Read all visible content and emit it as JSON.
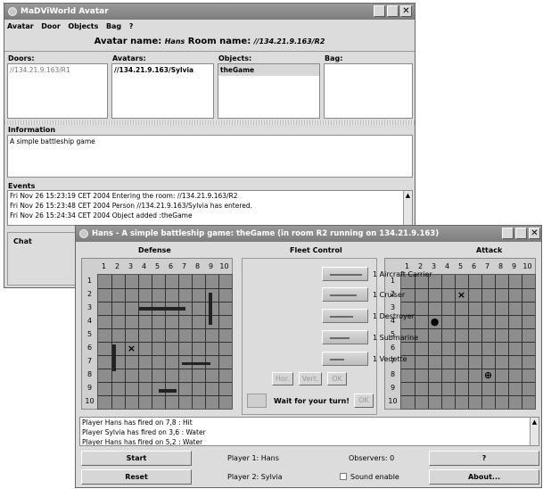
{
  "avatar_window": {
    "title": "MaDViWorld Avatar",
    "menu": [
      "Avatar",
      "Door",
      "Objects",
      "Bag",
      "?"
    ],
    "header": {
      "avatar_label": "Avatar name:",
      "avatar_value": "Hans",
      "room_label": "Room name:",
      "room_value": "//134.21.9.163/R2"
    },
    "columns": {
      "doors": {
        "title": "Doors:",
        "items": [
          "//134.21.9.163/R1"
        ]
      },
      "avatars": {
        "title": "Avatars:",
        "items": [
          "//134.21.9.163/Sylvia"
        ]
      },
      "objects": {
        "title": "Objects:",
        "items": [
          "theGame"
        ]
      },
      "bag": {
        "title": "Bag:",
        "items": []
      }
    },
    "information": {
      "title": "Information",
      "text": "A simple battleship game"
    },
    "events": {
      "title": "Events",
      "lines": [
        "Fri Nov 26 15:23:19 CET 2004 Entering the room: //134.21.9.163/R2",
        "Fri Nov 26 15:23:48 CET 2004 Person //134.21.9.163/Sylvia has entered.",
        "Fri Nov 26 15:24:34 CET 2004 Object added :theGame"
      ]
    },
    "chat": {
      "title": "Chat"
    }
  },
  "game_window": {
    "title": "Hans - A simple battleship game: theGame (in room R2 running on 134.21.9.163)",
    "defense_title": "Defense",
    "fleet_title": "Fleet Control",
    "attack_title": "Attack",
    "column_labels": [
      "1",
      "2",
      "3",
      "4",
      "5",
      "6",
      "7",
      "8",
      "9",
      "10"
    ],
    "row_labels": [
      "1",
      "2",
      "3",
      "4",
      "5",
      "6",
      "7",
      "8",
      "9",
      "10"
    ],
    "defense_marks": [
      {
        "row": 6,
        "col": 3,
        "symbol": "×"
      }
    ],
    "attack_marks": [
      {
        "row": 2,
        "col": 5,
        "symbol": "×"
      },
      {
        "row": 4,
        "col": 3,
        "symbol": "●"
      },
      {
        "row": 8,
        "col": 7,
        "symbol": "⊕"
      }
    ],
    "fleet": [
      "1 Aircraft Carrier",
      "1 Cruiser",
      "1 Destroyer",
      "1 Submarine",
      "1 Vedette"
    ],
    "orientation_buttons": [
      "Hor.",
      "Vert.",
      "OK"
    ],
    "turn_message": "Wait for your turn!",
    "turn_ok": "OK",
    "log": [
      "Player Hans has fired on 7,8 : Hit",
      "Player Sylvia has fired on 3,6 : Water",
      "Player Hans has fired on 5,2 : Water"
    ],
    "bottom": {
      "start": "Start",
      "reset": "Reset",
      "player1": "Player 1: Hans",
      "player2": "Player 2: Sylvia",
      "observers": "Observers: 0",
      "sound": "Sound enable",
      "help": "?",
      "about": "About..."
    }
  }
}
